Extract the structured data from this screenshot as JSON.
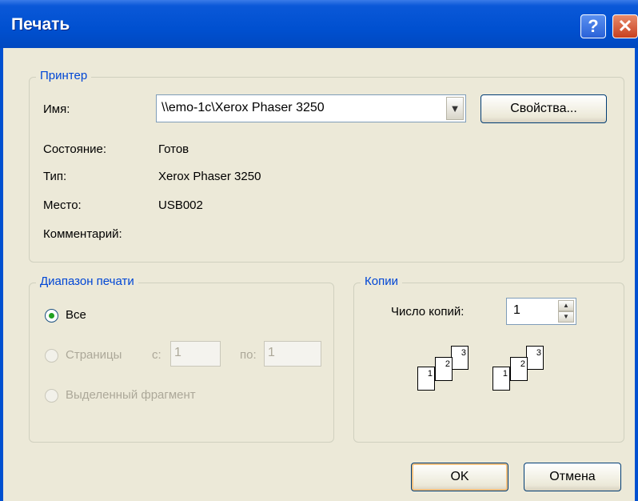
{
  "window": {
    "title": "Печать"
  },
  "titlebar": {
    "help_glyph": "?",
    "close_glyph": "✕"
  },
  "printer": {
    "legend": "Принтер",
    "name_label": "Имя:",
    "name_value": "\\\\emo-1c\\Xerox Phaser 3250",
    "properties_button": "Свойства...",
    "status_label": "Состояние:",
    "status_value": "Готов",
    "type_label": "Тип:",
    "type_value": "Xerox Phaser 3250",
    "location_label": "Место:",
    "location_value": "USB002",
    "comment_label": "Комментарий:"
  },
  "range": {
    "legend": "Диапазон печати",
    "all_label": "Все",
    "pages_label": "Страницы",
    "from_label": "с:",
    "from_value": "1",
    "to_label": "по:",
    "to_value": "1",
    "selection_label": "Выделенный фрагмент",
    "selected": "all"
  },
  "copies": {
    "legend": "Копии",
    "count_label": "Число копий:",
    "count_value": "1",
    "collate_pages": [
      "1",
      "2",
      "3"
    ]
  },
  "buttons": {
    "ok": "OK",
    "cancel": "Отмена"
  },
  "colors": {
    "title_bar": "#0050d0",
    "legend_text": "#0046d5",
    "dialog_bg": "#ECE9D8"
  }
}
